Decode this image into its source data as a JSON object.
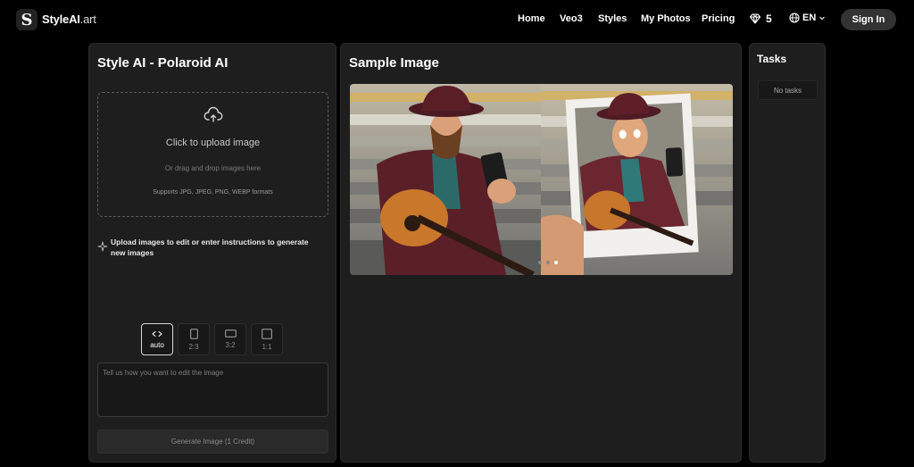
{
  "brand": {
    "name": "StyleAI",
    "suffix": ".art",
    "mark": "S"
  },
  "nav": {
    "home": "Home",
    "veo3": "Veo3",
    "styles": "Styles",
    "my_photos": "My Photos",
    "pricing": "Pricing"
  },
  "credits": "5",
  "language": "EN",
  "signin": "Sign In",
  "left": {
    "title": "Style AI - Polaroid AI",
    "upload_title": "Click to upload image",
    "upload_sub": "Or drag and drop images here",
    "upload_formats": "Supports JPG, JPEG, PNG, WEBP formats",
    "hint": "Upload images to edit or enter instructions to generate new images",
    "ratios": [
      "auto",
      "2:3",
      "3:2",
      "1:1"
    ],
    "selected_ratio": "auto",
    "prompt_placeholder": "Tell us how you want to edit the image",
    "prompt_value": "",
    "generate": "Generate Image (1 Credit)"
  },
  "middle": {
    "title": "Sample Image",
    "carousel_active": 3,
    "carousel_count": 3
  },
  "right": {
    "title": "Tasks",
    "empty": "No tasks"
  },
  "colors": {
    "background": "#000000",
    "panel": "#1e1e1e",
    "accent": "#ffffff"
  },
  "icons": [
    "logo-icon",
    "gem-icon",
    "globe-icon",
    "chevron-down-icon",
    "upload-cloud-icon",
    "sparkle-icon",
    "expand-arrows-icon",
    "portrait-icon",
    "landscape-icon",
    "square-icon"
  ]
}
